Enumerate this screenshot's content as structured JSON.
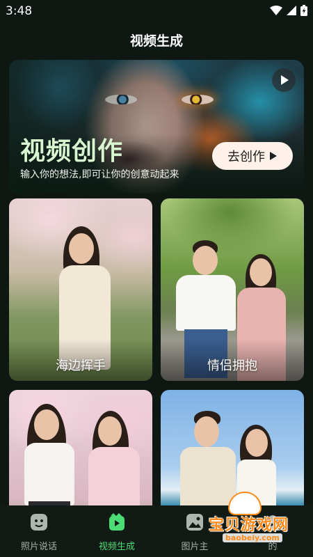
{
  "status": {
    "time": "3:48"
  },
  "header": {
    "title": "视频生成"
  },
  "hero": {
    "title": "视频创作",
    "subtitle": "输入你的想法,即可让你的创意动起来",
    "cta_label": "去创作"
  },
  "cards": [
    {
      "label": "海边挥手"
    },
    {
      "label": "情侣拥抱"
    },
    {
      "label": ""
    },
    {
      "label": ""
    }
  ],
  "tabs": [
    {
      "label": "照片说话",
      "icon": "photo-talk-icon",
      "active": false
    },
    {
      "label": "视频生成",
      "icon": "video-generate-icon",
      "active": true
    },
    {
      "label": "图片主",
      "icon": "image-icon",
      "active": false
    },
    {
      "label": "的",
      "icon": "profile-icon",
      "active": false
    }
  ],
  "watermark": {
    "text": "宝贝游戏网",
    "url": "baobeiy.com"
  },
  "colors": {
    "accent": "#4bdc74",
    "background": "#0f1712",
    "hero_title": "#d8f6d0",
    "cta_bg": "#fff2ea"
  }
}
